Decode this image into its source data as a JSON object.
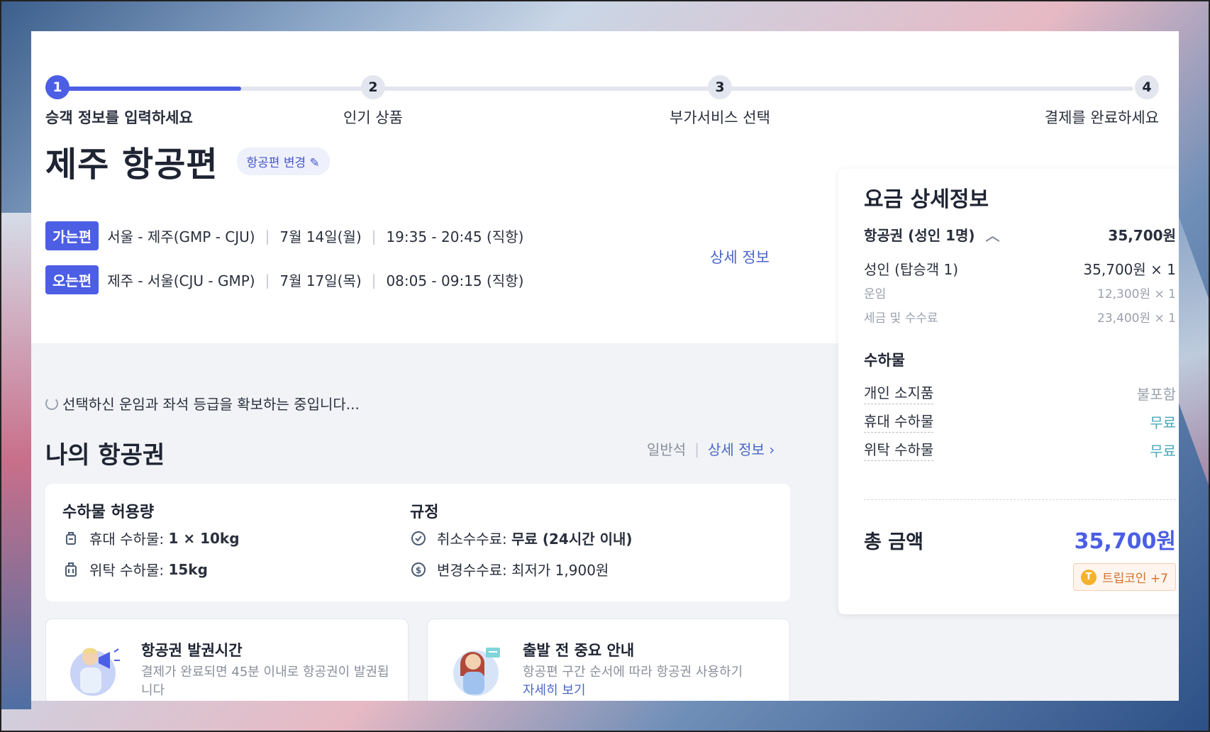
{
  "stepper": {
    "steps": [
      {
        "num": "1",
        "label": "승객 정보를 입력하세요"
      },
      {
        "num": "2",
        "label": "인기 상품"
      },
      {
        "num": "3",
        "label": "부가서비스 선택"
      },
      {
        "num": "4",
        "label": "결제를 완료하세요"
      }
    ],
    "active_step_progress": 0.17
  },
  "header": {
    "title": "제주 항공편",
    "change_label": "항공편 변경"
  },
  "flights": [
    {
      "tag": "가는편",
      "route": "서울 - 제주(GMP - CJU)",
      "date": "7월 14일(월)",
      "time": "19:35 - 20:45 (직항)"
    },
    {
      "tag": "오는편",
      "route": "제주 - 서울(CJU - GMP)",
      "date": "7월 17일(목)",
      "time": "08:05 - 09:15 (직항)"
    }
  ],
  "detail_link": "상세 정보",
  "loading_text": "선택하신 운임과 좌석 등급을 확보하는 중입니다...",
  "my_ticket": {
    "title": "나의 항공권",
    "seat_class": "일반석",
    "detail_link": "상세 정보 ›"
  },
  "baggage": {
    "title": "수하물 허용량",
    "carry_on_label": "휴대 수하물:",
    "carry_on_value": "1 × 10kg",
    "checked_label": "위탁 수하물:",
    "checked_value": "15kg"
  },
  "rules": {
    "title": "규정",
    "cancel_label": "취소수수료:",
    "cancel_value": "무료 (24시간 이내)",
    "change_label": "변경수수료:",
    "change_value": "최저가 1,900원"
  },
  "info_cards": [
    {
      "title": "항공권 발권시간",
      "desc": "결제가 완료되면 45분 이내로 항공권이 발권됩니다",
      "link": ""
    },
    {
      "title": "출발 전 중요 안내",
      "desc": "항공편 구간 순서에 따라 항공권 사용하기",
      "link": "자세히 보기"
    }
  ],
  "summary": {
    "title": "요금 상세정보",
    "ticket_label": "항공권 (성인 1명)",
    "ticket_total": "35,700원",
    "adult_label": "성인 (탑승객 1)",
    "adult_value": "35,700원 × 1",
    "fare_label": "운임",
    "fare_value": "12,300원 × 1",
    "tax_label": "세금 및 수수료",
    "tax_value": "23,400원 × 1",
    "baggage_title": "수하물",
    "personal_label": "개인 소지품",
    "personal_value": "불포함",
    "carry_label": "휴대 수하물",
    "carry_value": "무료",
    "checked_label": "위탁 수하물",
    "checked_value": "무료",
    "total_label": "총 금액",
    "total_value": "35,700원",
    "coin_label": "트립코인 +7",
    "coin_icon": "T"
  },
  "colors": {
    "accent": "#4b5ee4",
    "link": "#4a66c9",
    "free": "#4aa8b8"
  }
}
